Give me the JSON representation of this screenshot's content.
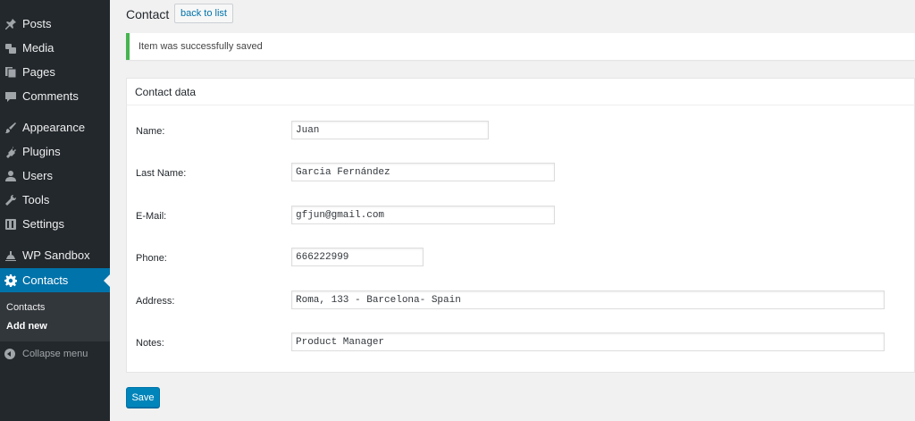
{
  "sidebar": {
    "items": [
      {
        "label": "Posts",
        "icon": "pin-icon"
      },
      {
        "label": "Media",
        "icon": "media-icon"
      },
      {
        "label": "Pages",
        "icon": "pages-icon"
      },
      {
        "label": "Comments",
        "icon": "comment-icon"
      },
      {
        "label": "Appearance",
        "icon": "brush-icon"
      },
      {
        "label": "Plugins",
        "icon": "plug-icon"
      },
      {
        "label": "Users",
        "icon": "user-icon"
      },
      {
        "label": "Tools",
        "icon": "wrench-icon"
      },
      {
        "label": "Settings",
        "icon": "settings-icon"
      },
      {
        "label": "WP Sandbox",
        "icon": "sandbox-icon"
      },
      {
        "label": "Contacts",
        "icon": "gear-icon"
      }
    ],
    "submenu": [
      "Contacts",
      "Add new"
    ],
    "collapse_label": "Collapse menu",
    "active_color": "#0073aa"
  },
  "header": {
    "title": "Contact",
    "back_label": "back to list"
  },
  "notice": {
    "text": "Item was successfully saved",
    "color": "#46b450"
  },
  "form": {
    "section_title": "Contact data",
    "fields": [
      {
        "label": "Name:",
        "value": "Juan"
      },
      {
        "label": "Last Name:",
        "value": "Garcia Fernández"
      },
      {
        "label": "E-Mail:",
        "value": "gfjun@gmail.com"
      },
      {
        "label": "Phone:",
        "value": "666222999"
      },
      {
        "label": "Address:",
        "value": "Roma, 133 - Barcelona- Spain"
      },
      {
        "label": "Notes:",
        "value": "Product Manager"
      }
    ],
    "save_label": "Save"
  }
}
